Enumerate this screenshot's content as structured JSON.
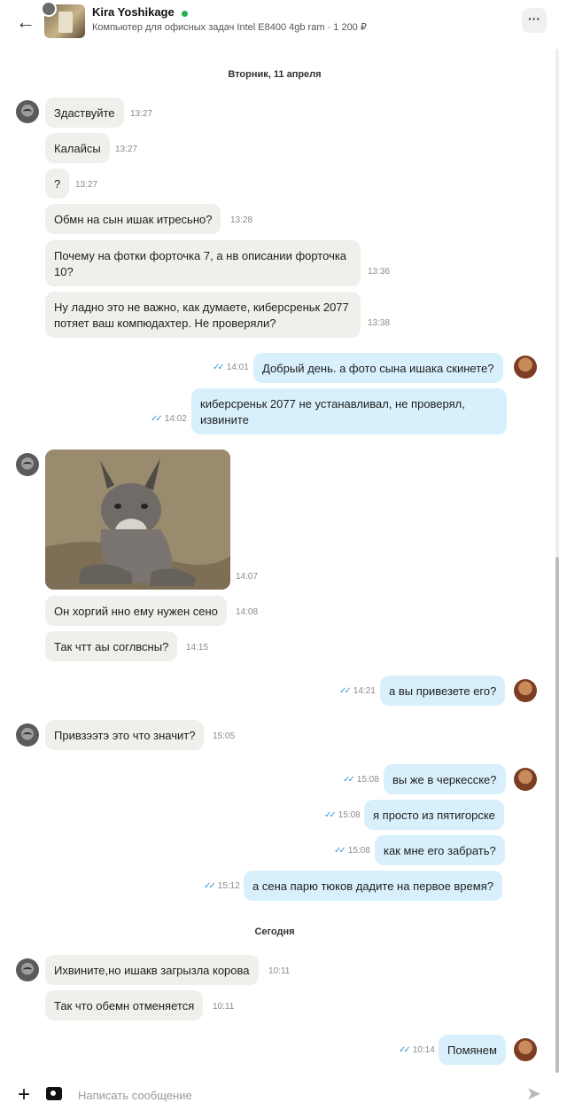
{
  "header": {
    "name": "Kira Yoshikage",
    "product": "Компьютер для офисных задач Intel E8400 4gb ram · 1 200 ₽",
    "more_label": "···",
    "icons": {
      "back": "arrow-left-icon",
      "more": "dots-icon"
    }
  },
  "date_separators": [
    "Вторник, 11 апреля",
    "Сегодня"
  ],
  "messages": [
    {
      "from": "seller",
      "text": "Здаствуйте",
      "time": "13:27"
    },
    {
      "from": "seller",
      "text": "Калайсы",
      "time": "13:27"
    },
    {
      "from": "seller",
      "text": "?",
      "time": "13:27"
    },
    {
      "from": "seller",
      "text": "Обмн на сын ишак итресьно?",
      "time": "13:28"
    },
    {
      "from": "seller",
      "text": "Почему на фотки форточка 7, а нв описании форточка 10?",
      "time": "13:36"
    },
    {
      "from": "seller",
      "text": "Ну ладно это не важно, как думаете, киберсреньк 2077 потяет ваш компюдахтер. Не проверяли?",
      "time": "13:38"
    },
    {
      "from": "me",
      "text": "Добрый день. а фото сына ишака скинете?",
      "time": "14:01"
    },
    {
      "from": "me",
      "text": "киберсреньк 2077 не устанавливал, не проверял, извините",
      "time": "14:02"
    },
    {
      "from": "seller",
      "type": "image",
      "image": "donkey-photo",
      "time": "14:07"
    },
    {
      "from": "seller",
      "text": "Он хоргий нно ему нужен сено",
      "time": "14:08"
    },
    {
      "from": "seller",
      "text": "Так чтт аы соглвсны?",
      "time": "14:15"
    },
    {
      "from": "me",
      "text": "а вы привезете его?",
      "time": "14:21"
    },
    {
      "from": "seller",
      "text": "Привзээтэ это что значит?",
      "time": "15:05"
    },
    {
      "from": "me",
      "text": "вы же в черкесске?",
      "time": "15:08"
    },
    {
      "from": "me",
      "text": "я просто из пятигорске",
      "time": "15:08"
    },
    {
      "from": "me",
      "text": "как мне его забрать?",
      "time": "15:08"
    },
    {
      "from": "me",
      "text": "а сена парю тюков дадите на первое время?",
      "time": "15:12"
    },
    {
      "from": "seller",
      "text": "Ихвините,но ишакв загрызла корова",
      "time": "10:11"
    },
    {
      "from": "seller",
      "text": "Так что обемн отменяется",
      "time": "10:11"
    },
    {
      "from": "me",
      "text": "Помянем",
      "time": "10:14"
    }
  ],
  "composer": {
    "placeholder": "Написать сообщение",
    "icons": {
      "attach": "plus-icon",
      "camera": "camera-icon",
      "send": "send-icon"
    }
  },
  "colors": {
    "incoming_bubble": "#f1efeb",
    "outgoing_bubble": "#d8f0fc",
    "read_ticks": "#3a95d6",
    "online": "#22b14c"
  }
}
